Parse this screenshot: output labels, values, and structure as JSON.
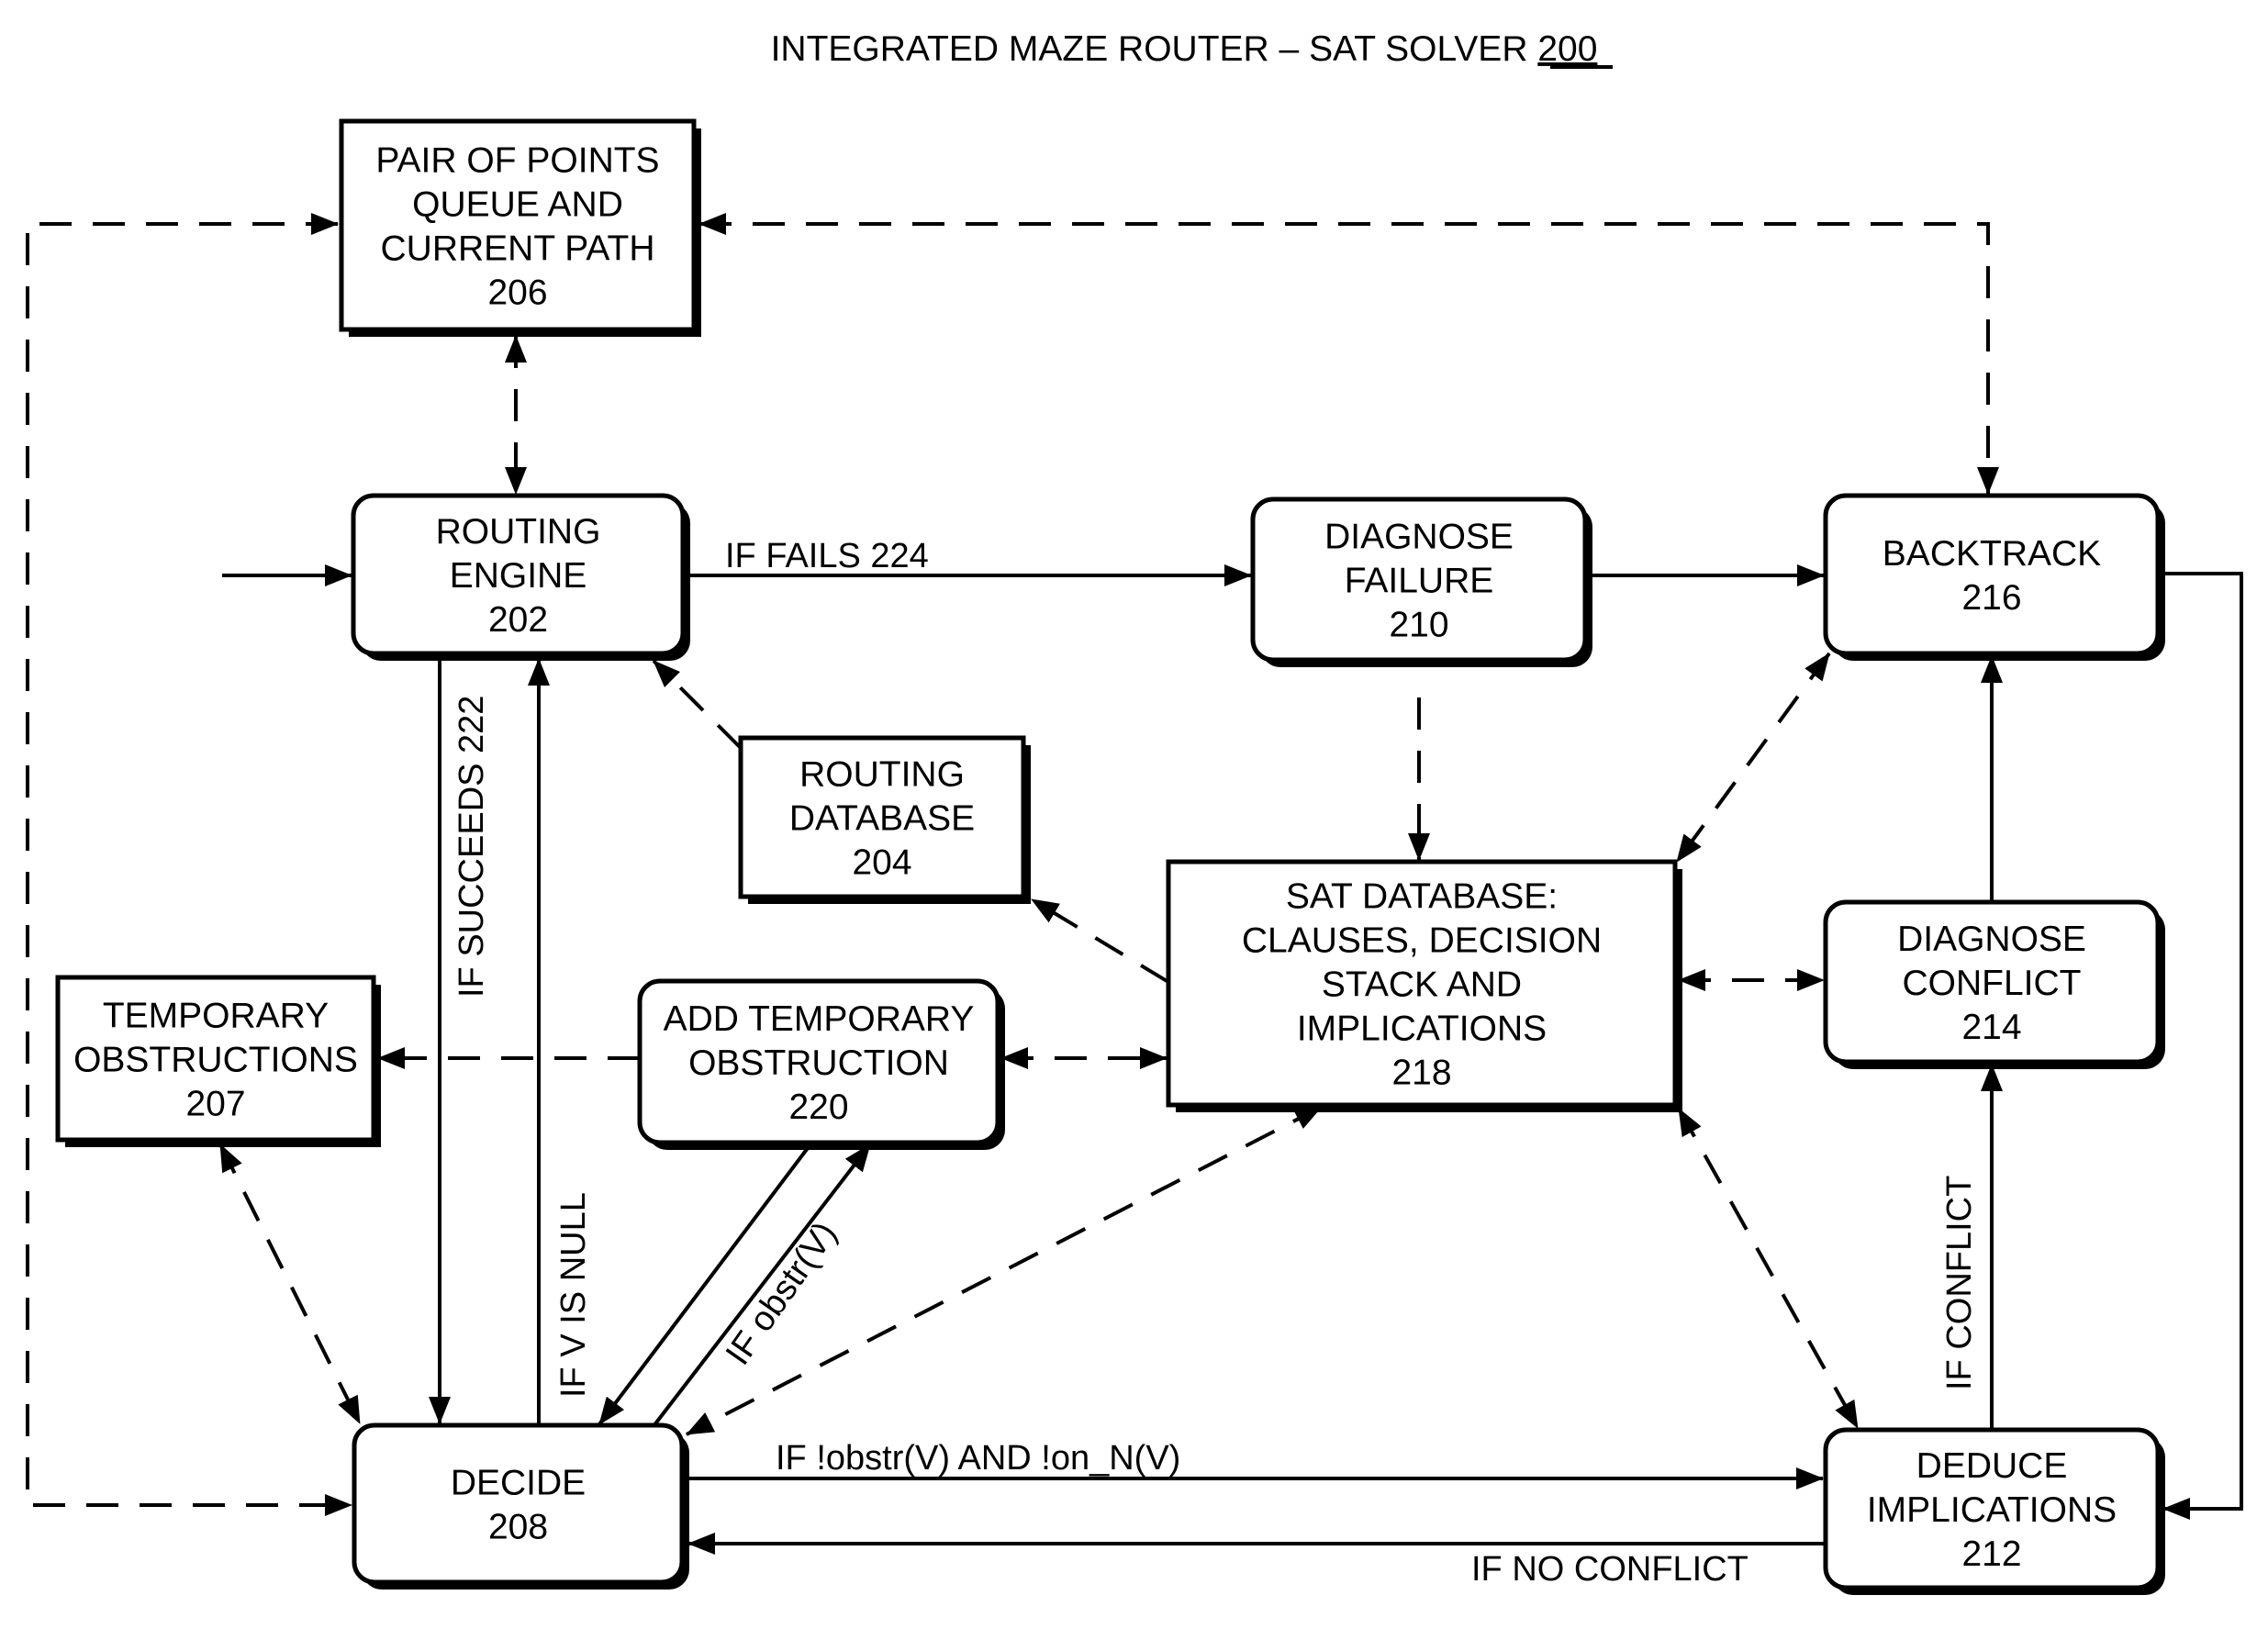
{
  "title": {
    "text": "INTEGRATED MAZE ROUTER – SAT SOLVER ",
    "ref": "200"
  },
  "blocks": [
    {
      "id": "206",
      "name": "pair-of-points-queue",
      "lines": [
        "PAIR OF POINTS",
        "QUEUE AND",
        "CURRENT PATH",
        "206"
      ],
      "shape": "square"
    },
    {
      "id": "202",
      "name": "routing-engine",
      "lines": [
        "ROUTING",
        "ENGINE",
        "202"
      ],
      "shape": "rounded"
    },
    {
      "id": "210",
      "name": "diagnose-failure",
      "lines": [
        "DIAGNOSE",
        "FAILURE",
        "210"
      ],
      "shape": "rounded"
    },
    {
      "id": "216",
      "name": "backtrack",
      "lines": [
        "BACKTRACK",
        "216"
      ],
      "shape": "rounded"
    },
    {
      "id": "204",
      "name": "routing-database",
      "lines": [
        "ROUTING",
        "DATABASE",
        "204"
      ],
      "shape": "square"
    },
    {
      "id": "218",
      "name": "sat-database",
      "lines": [
        "SAT DATABASE:",
        "CLAUSES, DECISION",
        "STACK AND",
        "IMPLICATIONS",
        "218"
      ],
      "shape": "square"
    },
    {
      "id": "214",
      "name": "diagnose-conflict",
      "lines": [
        "DIAGNOSE",
        "CONFLICT",
        "214"
      ],
      "shape": "rounded"
    },
    {
      "id": "207",
      "name": "temporary-obstructions",
      "lines": [
        "TEMPORARY",
        "OBSTRUCTIONS",
        "207"
      ],
      "shape": "square"
    },
    {
      "id": "220",
      "name": "add-temporary-obstruction",
      "lines": [
        "ADD TEMPORARY",
        "OBSTRUCTION",
        "220"
      ],
      "shape": "rounded"
    },
    {
      "id": "208",
      "name": "decide",
      "lines": [
        "DECIDE",
        "208"
      ],
      "shape": "rounded"
    },
    {
      "id": "212",
      "name": "deduce-implications",
      "lines": [
        "DEDUCE",
        "IMPLICATIONS",
        "212"
      ],
      "shape": "rounded"
    }
  ],
  "edge_labels": {
    "if_fails": "IF FAILS 224",
    "if_succeeds": "IF SUCCEEDS 222",
    "if_v_is_null": "IF V IS NULL",
    "if_obstr": "IF obstr(V)",
    "if_not_obstr": "IF !obstr(V) AND !on_N(V)",
    "if_no_conflict": "IF NO CONFLICT",
    "if_conflict": "IF CONFLICT"
  },
  "connections": [
    {
      "from": "entry",
      "to": "202",
      "style": "solid"
    },
    {
      "from": "202",
      "to": "210",
      "style": "solid",
      "label": "if_fails"
    },
    {
      "from": "210",
      "to": "216",
      "style": "solid"
    },
    {
      "from": "210",
      "to": "218",
      "style": "dashed"
    },
    {
      "from": "202",
      "to": "206",
      "style": "dashed",
      "bidirectional": true
    },
    {
      "from": "206",
      "to": "216",
      "style": "dashed",
      "bidirectional": true
    },
    {
      "from": "208",
      "to": "206",
      "style": "dashed",
      "bidirectional": true
    },
    {
      "from": "202",
      "to": "208",
      "style": "solid",
      "label": "if_succeeds"
    },
    {
      "from": "208",
      "to": "202",
      "style": "solid",
      "label": "if_v_is_null"
    },
    {
      "from": "218",
      "to": "204",
      "style": "dashed"
    },
    {
      "from": "204",
      "to": "202",
      "style": "dashed"
    },
    {
      "from": "220",
      "to": "207",
      "style": "dashed"
    },
    {
      "from": "220",
      "to": "218",
      "style": "dashed",
      "bidirectional": true
    },
    {
      "from": "207",
      "to": "208",
      "style": "dashed",
      "bidirectional": true
    },
    {
      "from": "220",
      "to": "208",
      "style": "solid"
    },
    {
      "from": "208",
      "to": "220",
      "style": "solid",
      "label": "if_obstr"
    },
    {
      "from": "218",
      "to": "208",
      "style": "dashed",
      "bidirectional": true
    },
    {
      "from": "208",
      "to": "212",
      "style": "solid",
      "label": "if_not_obstr"
    },
    {
      "from": "212",
      "to": "208",
      "style": "solid",
      "label": "if_no_conflict"
    },
    {
      "from": "212",
      "to": "214",
      "style": "solid",
      "label": "if_conflict"
    },
    {
      "from": "214",
      "to": "216",
      "style": "solid"
    },
    {
      "from": "216",
      "to": "212",
      "style": "solid"
    },
    {
      "from": "216",
      "to": "218",
      "style": "dashed",
      "bidirectional": true
    },
    {
      "from": "218",
      "to": "214",
      "style": "dashed",
      "bidirectional": true
    },
    {
      "from": "218",
      "to": "212",
      "style": "dashed",
      "bidirectional": true
    }
  ]
}
